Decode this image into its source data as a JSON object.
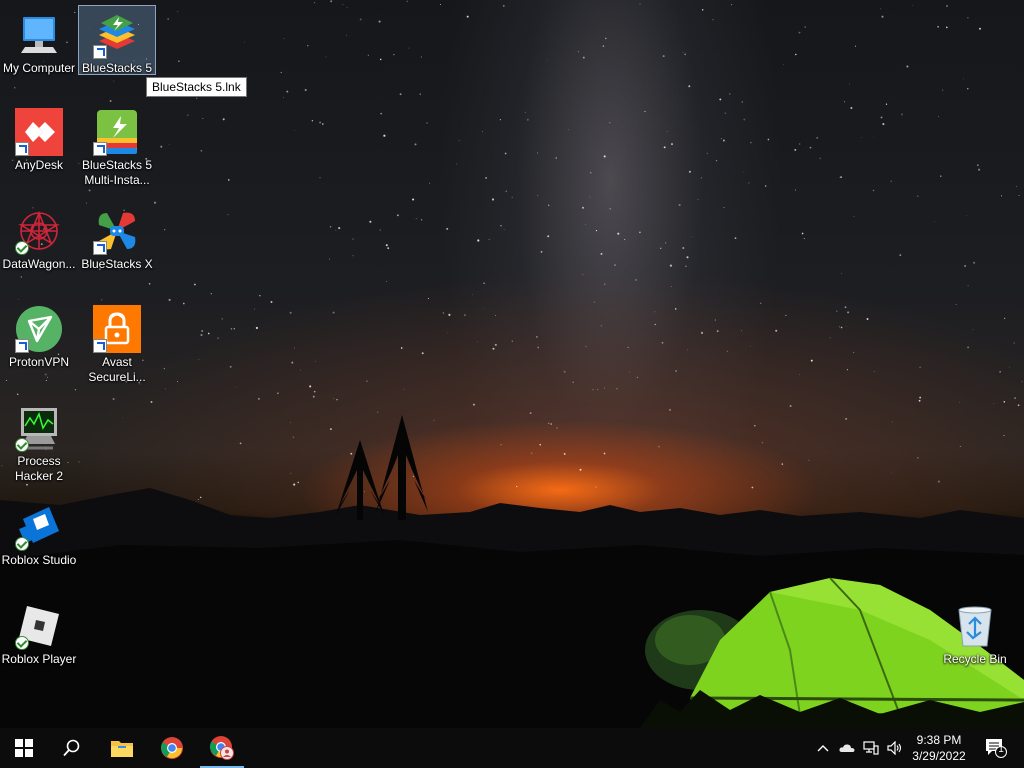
{
  "desktop": {
    "icons": [
      {
        "label": "My Computer"
      },
      {
        "label": "BlueStacks 5"
      },
      {
        "label": "AnyDesk"
      },
      {
        "label": "BlueStacks 5 Multi-Insta..."
      },
      {
        "label": "DataWagon..."
      },
      {
        "label": "BlueStacks X"
      },
      {
        "label": "ProtonVPN"
      },
      {
        "label": "Avast SecureLi..."
      },
      {
        "label": "Process Hacker 2"
      },
      {
        "label": "Roblox Studio"
      },
      {
        "label": "Roblox Player"
      },
      {
        "label": "Recycle Bin"
      }
    ],
    "tooltip": "BlueStacks 5.lnk"
  },
  "taskbar": {
    "time": "9:38 PM",
    "date": "3/29/2022",
    "notification_count": "1"
  },
  "colors": {
    "taskbar_bg": "#0c0c0c",
    "active_indicator": "#76b9ed",
    "selection": "#78a0c8"
  }
}
